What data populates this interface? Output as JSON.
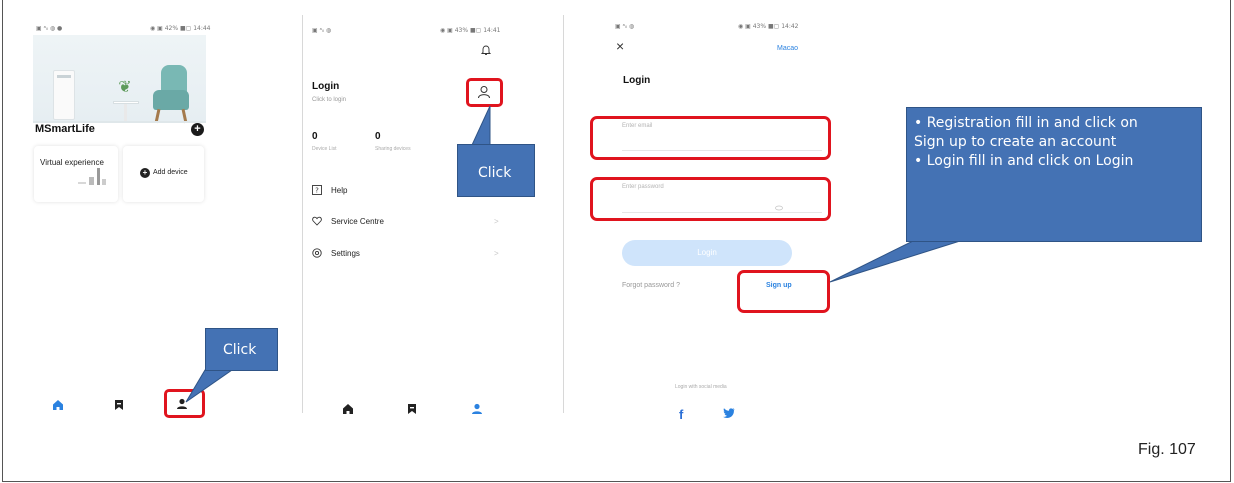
{
  "colors": {
    "accent_blue": "#2b82e0",
    "callout_fill": "#4472b4",
    "highlight_red": "#e0141e",
    "login_button_disabled": "#cfe4fb"
  },
  "screen_home": {
    "status_left": "▣ ᵃᵢₗ ◍ ●",
    "status_right": "◉ ▣ 42% ■▢ 14:44",
    "app_title": "MSmartLife",
    "virtual_card_label": "Virtual experience",
    "add_device_label": "Add device",
    "nav_icons": [
      "home-icon",
      "bookmark-icon",
      "profile-icon"
    ]
  },
  "screen_profile": {
    "status_left": "▣ ᵃᵢₗ ◍",
    "status_right": "◉ ▣ 43% ■▢ 14:41",
    "login_title": "Login",
    "login_subtitle": "Click to login",
    "device_count": "0",
    "device_label": "Device List",
    "sharing_count": "0",
    "sharing_label": "Sharing devices",
    "menu": [
      {
        "label": "Help",
        "icon": "help-icon"
      },
      {
        "label": "Service Centre",
        "icon": "service-icon"
      },
      {
        "label": "Settings",
        "icon": "settings-icon"
      }
    ],
    "chevron": ">"
  },
  "screen_login": {
    "status_left": "▣ ᵃᵢₗ ◍",
    "status_right": "◉ ▣ 43% ■▢ 14:42",
    "close_symbol": "×",
    "region": "Macao",
    "title": "Login",
    "email_placeholder": "Enter email",
    "password_placeholder": "Enter password",
    "login_button": "Login",
    "forgot_password": "Forgot password ?",
    "sign_up": "Sign up",
    "social_label": "Login with social media",
    "facebook_glyph": "f",
    "twitter_glyph": "🐦"
  },
  "callouts": {
    "click_1": "Click",
    "click_2": "Click",
    "note_line1": "• Registration fill in and click on",
    "note_line2": "Sign up to create an account",
    "note_line3": "• Login fill in and click on Login"
  },
  "figure_label": "Fig. 107"
}
